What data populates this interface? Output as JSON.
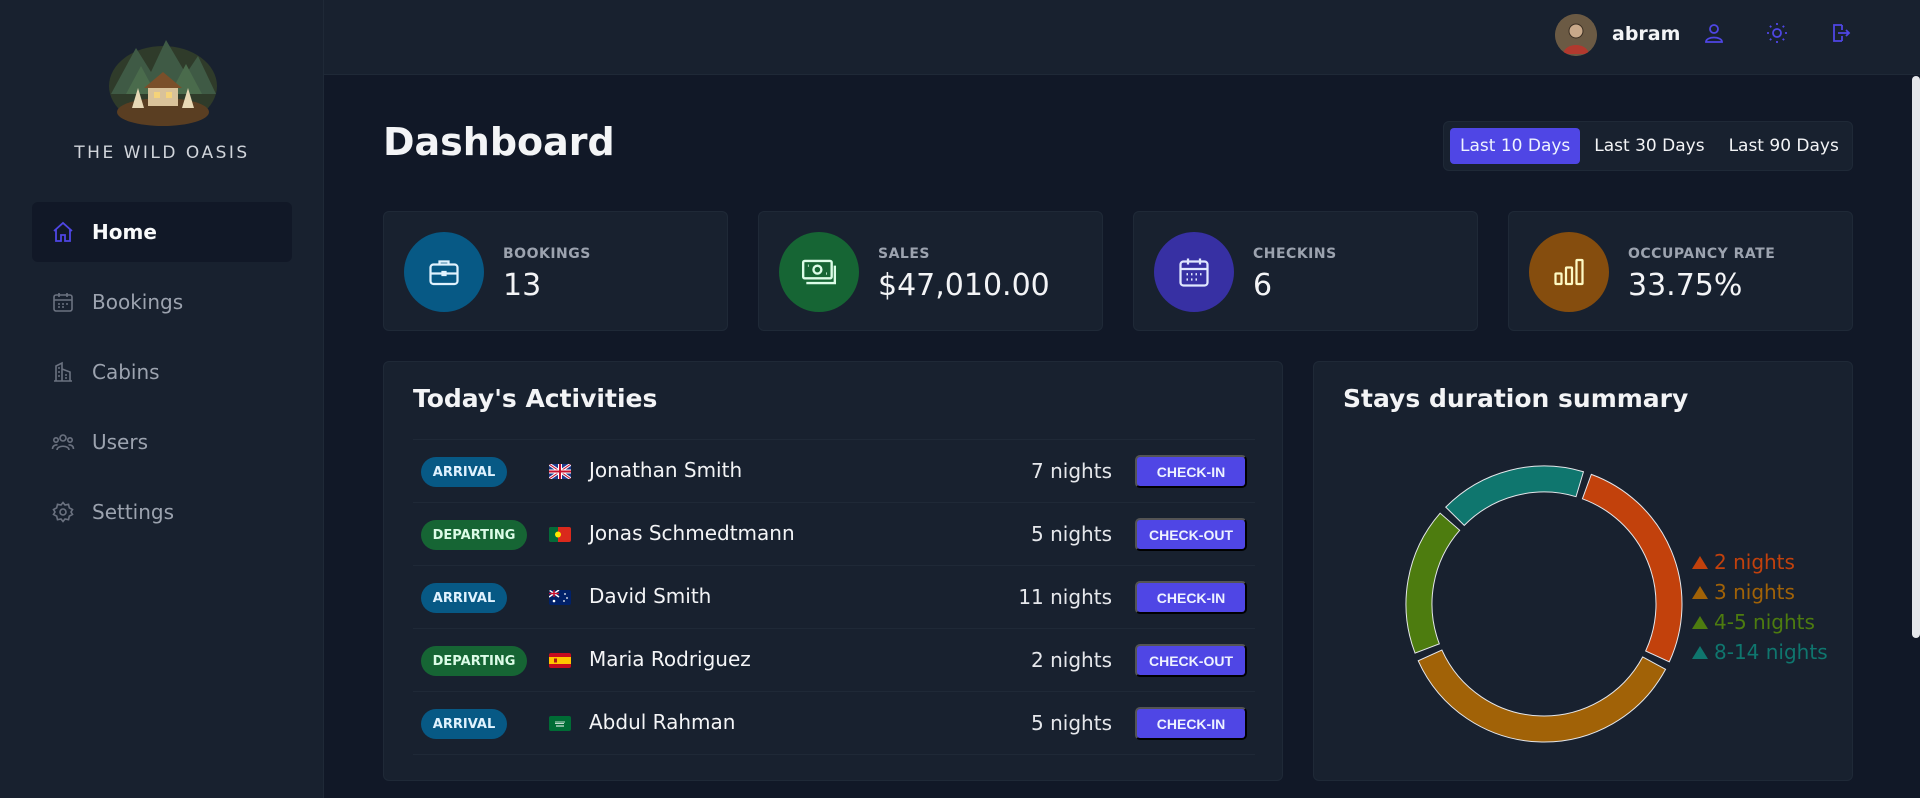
{
  "app": {
    "brand": "THE WILD OASIS"
  },
  "sidebar": {
    "items": [
      {
        "label": "Home",
        "icon": "home-icon",
        "active": true
      },
      {
        "label": "Bookings",
        "icon": "calendar-icon"
      },
      {
        "label": "Cabins",
        "icon": "building-icon"
      },
      {
        "label": "Users",
        "icon": "users-icon"
      },
      {
        "label": "Settings",
        "icon": "gear-icon"
      }
    ]
  },
  "header": {
    "username": "abram"
  },
  "main": {
    "title": "Dashboard",
    "filters": [
      "Last 10 Days",
      "Last 30 Days",
      "Last 90 Days"
    ],
    "active_filter": "Last 10 Days",
    "stats": [
      {
        "label": "BOOKINGS",
        "value": "13",
        "icon": "briefcase-icon",
        "color": "#075985"
      },
      {
        "label": "SALES",
        "value": "$47,010.00",
        "icon": "banknotes-icon",
        "color": "#166534"
      },
      {
        "label": "CHECKINS",
        "value": "6",
        "icon": "calendar-days-icon",
        "color": "#3730a3"
      },
      {
        "label": "OCCUPANCY RATE",
        "value": "33.75%",
        "icon": "chart-bar-icon",
        "color": "#854d0e"
      }
    ],
    "activities": {
      "title": "Today's Activities",
      "rows": [
        {
          "status": "ARRIVAL",
          "flag": "gb-flag-icon",
          "guest": "Jonathan Smith",
          "nights": "7 nights",
          "action": "CHECK-IN"
        },
        {
          "status": "DEPARTING",
          "flag": "pt-flag-icon",
          "guest": "Jonas Schmedtmann",
          "nights": "5 nights",
          "action": "CHECK-OUT"
        },
        {
          "status": "ARRIVAL",
          "flag": "au-flag-icon",
          "guest": "David Smith",
          "nights": "11 nights",
          "action": "CHECK-IN"
        },
        {
          "status": "DEPARTING",
          "flag": "es-flag-icon",
          "guest": "Maria Rodriguez",
          "nights": "2 nights",
          "action": "CHECK-OUT"
        },
        {
          "status": "ARRIVAL",
          "flag": "sa-flag-icon",
          "guest": "Abdul Rahman",
          "nights": "5 nights",
          "action": "CHECK-IN"
        }
      ]
    },
    "stays": {
      "title": "Stays duration summary"
    }
  },
  "colors": {
    "accent": "#4f46e5",
    "bg": "#111827",
    "panel": "#18212f"
  },
  "chart_data": {
    "type": "pie",
    "title": "Stays duration summary",
    "legend_position": "right",
    "slices": [
      {
        "label": "2 nights",
        "value": 3,
        "color": "#c2410c"
      },
      {
        "label": "3 nights",
        "value": 4,
        "color": "#a16207"
      },
      {
        "label": "4-5 nights",
        "value": 2,
        "color": "#4d7c0f"
      },
      {
        "label": "8-14 nights",
        "value": 2,
        "color": "#0f766e"
      }
    ]
  }
}
